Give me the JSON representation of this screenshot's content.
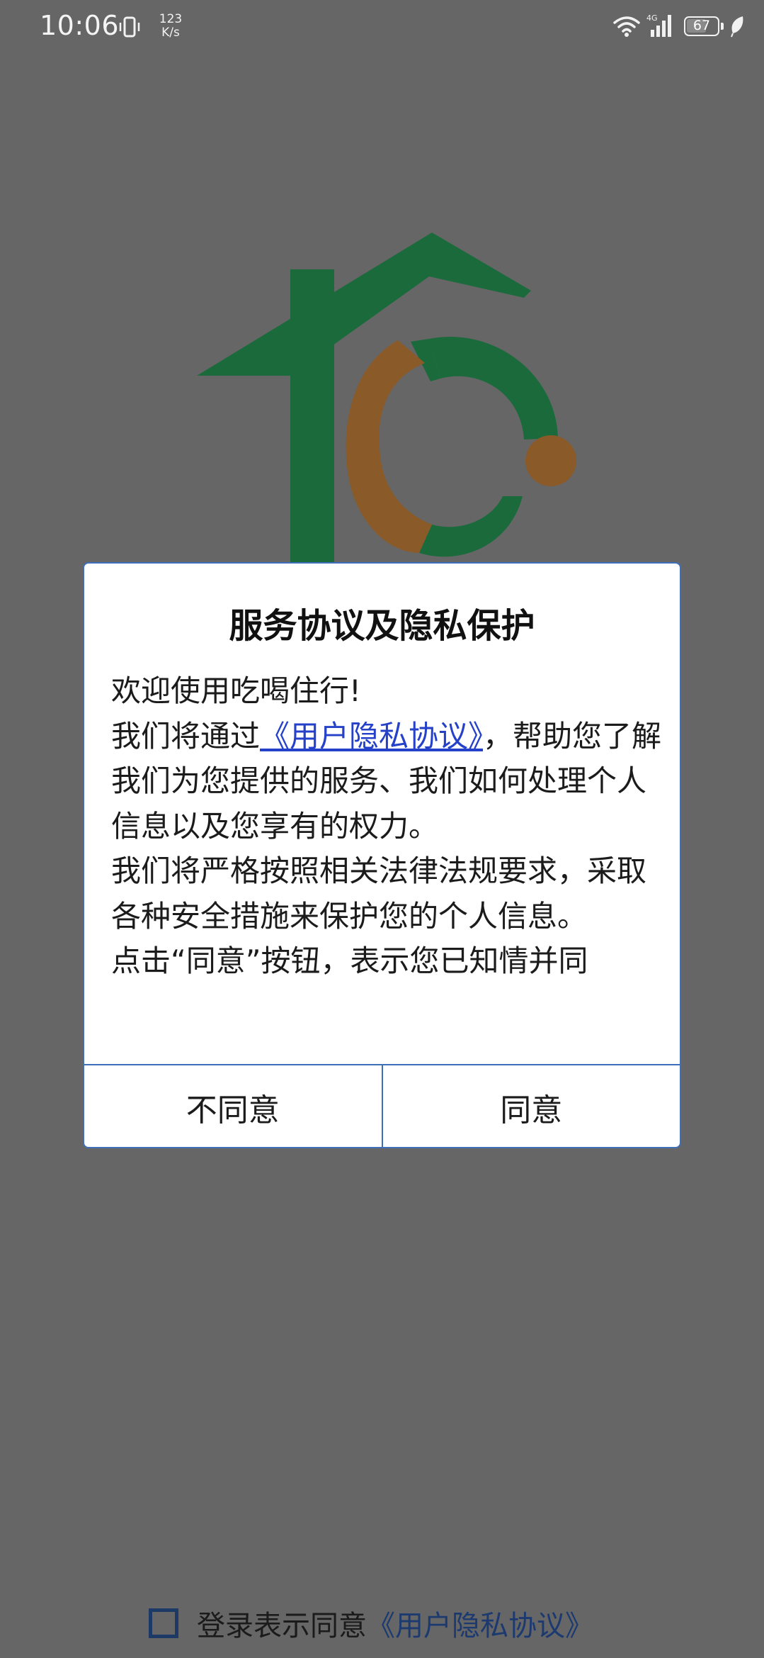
{
  "status_bar": {
    "time": "10:06",
    "net_speed_value": "123",
    "net_speed_unit": "K/s",
    "battery": "67",
    "battery_level": 0.67,
    "icons": [
      "vibrate-icon",
      "wifi-icon",
      "signal-4g-icon",
      "battery-icon",
      "leaf-icon"
    ]
  },
  "logo": {
    "icon": "house-c-logo",
    "colors": {
      "house": "#1b6a3c",
      "arc": "#8a5a28"
    }
  },
  "dialog": {
    "title": "服务协议及隐私保护",
    "line1": "欢迎使用吃喝住行!",
    "line2_prefix": "我们将通过",
    "policy_link": "《用户隐私协议》",
    "line2_suffix": "，帮助您了解我们为您提供的服务、我们如何处理个人信息以及您享有的权力。",
    "line3": "我们将严格按照相关法律法规要求，采取各种安全措施来保护您的个人信息。",
    "line4": "点击“同意”按钮，表示您已知情并同",
    "decline_button": "不同意",
    "agree_button": "同意"
  },
  "agreement": {
    "text": "登录表示同意",
    "link": "《用户隐私协议》",
    "checked": false
  },
  "colors": {
    "overlay": "#666666",
    "dialog_border": "#3f6fb8",
    "link": "#2541c9"
  }
}
